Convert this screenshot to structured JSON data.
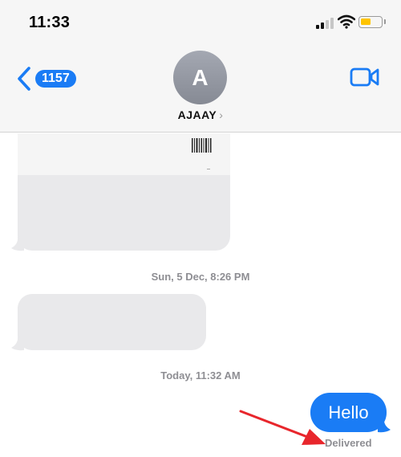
{
  "status_bar": {
    "time": "11:33",
    "signal_icon": "cellular-signal-icon",
    "wifi_icon": "wifi-icon",
    "battery_icon": "battery-icon",
    "battery_level": 0.5,
    "battery_color": "#ffc400"
  },
  "header": {
    "back_count": "1157",
    "back_icon": "chevron-left-icon",
    "avatar_initial": "A",
    "contact_name": "AJAAY",
    "name_chevron": "›",
    "video_icon": "video-camera-icon"
  },
  "messages": [
    {
      "type": "received-image",
      "barcode_icon": "barcode-icon"
    },
    {
      "type": "timestamp",
      "text": "Sun, 5 Dec, 8:26 PM"
    },
    {
      "type": "received-text",
      "text": ""
    },
    {
      "type": "timestamp",
      "text": "Today, 11:32 AM"
    },
    {
      "type": "sent-text",
      "text": "Hello",
      "status": "Delivered"
    }
  ],
  "annotation": {
    "icon": "red-arrow-icon",
    "color": "#e8262c"
  },
  "colors": {
    "accent": "#1a7cf5",
    "received_bubble": "#e9e9eb",
    "header_bg": "#f6f6f6",
    "meta_text": "#8e8e93"
  }
}
